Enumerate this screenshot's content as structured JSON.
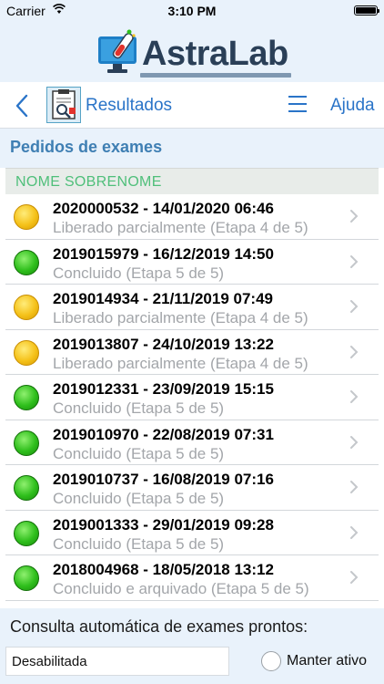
{
  "status_bar": {
    "carrier": "Carrier",
    "time": "3:10 PM"
  },
  "brand": {
    "name": "AstraLab",
    "logo_icon": "test-tube-monitor-icon"
  },
  "navbar": {
    "back_icon": "chevron-left-icon",
    "title": "Resultados",
    "menu_icon": "hamburger-menu-icon",
    "help_label": "Ajuda"
  },
  "section": {
    "title": "Pedidos de exames"
  },
  "patient": {
    "name": "NOME SOBRENOME"
  },
  "colors": {
    "accent_blue": "#2a74c8",
    "section_blue": "#3f7fb3",
    "patient_green": "#4fbf7a",
    "status_partial": "#f5c21a",
    "status_done": "#2fbf1c",
    "background": "#e9f2fb"
  },
  "orders": [
    {
      "title": "2020000532 - 14/01/2020 06:46",
      "status": "Liberado parcialmente (Etapa 4 de 5)",
      "status_color": "yellow"
    },
    {
      "title": "2019015979 - 16/12/2019 14:50",
      "status": "Concluido (Etapa 5 de 5)",
      "status_color": "green"
    },
    {
      "title": "2019014934 - 21/11/2019 07:49",
      "status": "Liberado parcialmente (Etapa 4 de 5)",
      "status_color": "yellow"
    },
    {
      "title": "2019013807 - 24/10/2019 13:22",
      "status": "Liberado parcialmente (Etapa 4 de 5)",
      "status_color": "yellow"
    },
    {
      "title": "2019012331 - 23/09/2019 15:15",
      "status": "Concluido (Etapa 5 de 5)",
      "status_color": "green"
    },
    {
      "title": "2019010970 - 22/08/2019 07:31",
      "status": "Concluido (Etapa 5 de 5)",
      "status_color": "green"
    },
    {
      "title": "2019010737 - 16/08/2019 07:16",
      "status": "Concluido (Etapa 5 de 5)",
      "status_color": "green"
    },
    {
      "title": "2019001333 - 29/01/2019 09:28",
      "status": "Concluido (Etapa 5 de 5)",
      "status_color": "green"
    },
    {
      "title": "2018004968 - 18/05/2018 13:12",
      "status": "Concluido e arquivado (Etapa 5 de 5)",
      "status_color": "green"
    }
  ],
  "footer": {
    "auto_label": "Consulta automática de exames prontos:",
    "select_value": "Desabilitada",
    "keep_active_label": "Manter ativo",
    "keep_active_checked": false
  }
}
